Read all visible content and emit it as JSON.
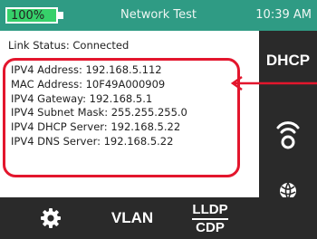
{
  "status_bar": {
    "battery_text": "100%",
    "battery_level": 1.0,
    "title": "Network Test",
    "clock": "10:39 AM"
  },
  "main": {
    "link_status": "Link Status: Connected",
    "info_lines": [
      "IPV4 Address: 192.168.5.112",
      "MAC Address: 10F49A000909",
      "IPV4 Gateway: 192.168.5.1",
      "IPV4 Subnet Mask: 255.255.255.0",
      "IPV4 DHCP Server: 192.168.5.22",
      "IPV4 DNS Server: 192.168.5.22"
    ]
  },
  "right_panel": {
    "dhcp_label": "DHCP"
  },
  "bottom_bar": {
    "vlan_label": "VLAN",
    "lldp_label": "LLDP",
    "cdp_label": "CDP"
  },
  "colors": {
    "status_bar": "#2f9b84",
    "panel": "#2a2a2a",
    "highlight": "#e3162d",
    "battery_fill": "#36d06a"
  },
  "icons": {
    "settings": "gear-icon",
    "wifi": "wifi-icon",
    "network": "globe-icon",
    "battery": "battery-icon"
  }
}
